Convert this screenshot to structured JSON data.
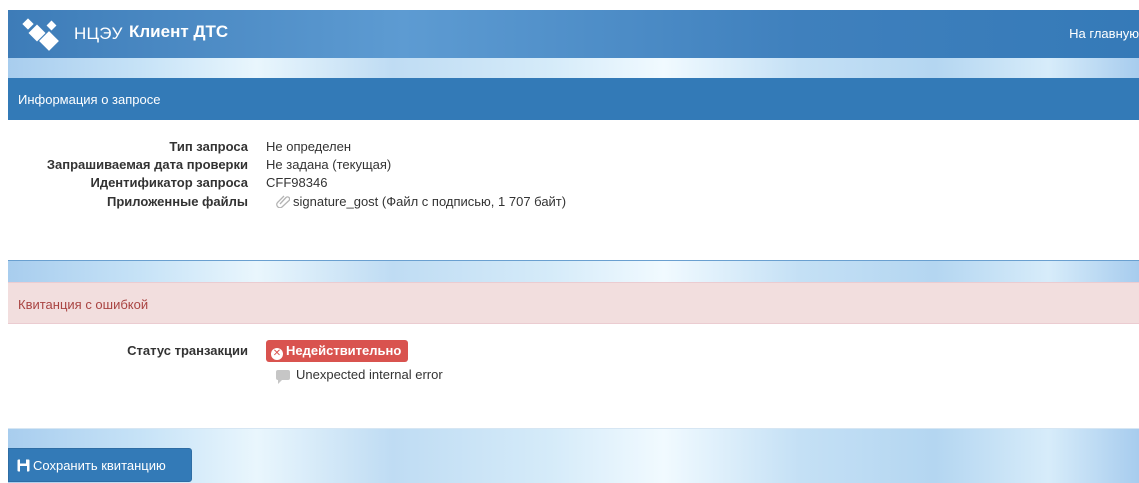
{
  "navbar": {
    "org": "НЦЭУ",
    "app_title": "Клиент ДТС",
    "home_link": "На главную"
  },
  "request_panel": {
    "title": "Информация о запросе",
    "fields": {
      "type_label": "Тип запроса",
      "type_value": "Не определен",
      "date_label": "Запрашиваемая дата проверки",
      "date_value": "Не задана (текущая)",
      "id_label": "Идентификатор запроса",
      "id_value": "CFF98346",
      "files_label": "Приложенные файлы",
      "files_value": "signature_gost (Файл с подписью, 1 707 байт)"
    }
  },
  "receipt_panel": {
    "title": "Квитанция с ошибкой",
    "status_label": "Статус транзакции",
    "status_badge": "Недействительно",
    "error_message": "Unexpected internal error"
  },
  "actions": {
    "save_label": "Сохранить квитанцию"
  },
  "colors": {
    "primary": "#337ab7",
    "danger": "#d9534f",
    "danger_bg": "#f2dede",
    "danger_text": "#a94442"
  },
  "icons": [
    "logo-icon",
    "paperclip-icon",
    "remove-circle-icon",
    "comment-icon",
    "save-icon"
  ]
}
